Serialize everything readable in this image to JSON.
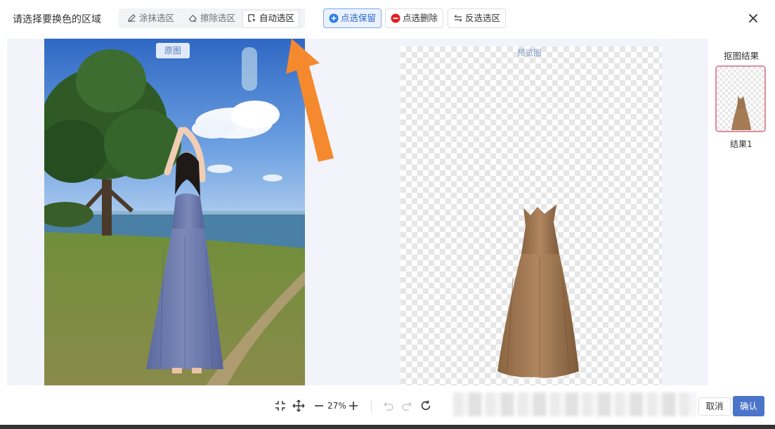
{
  "header": {
    "title": "请选择要换色的区域",
    "modes": [
      {
        "label": "涂抹选区",
        "icon": "pencil-icon",
        "active": false
      },
      {
        "label": "擦除选区",
        "icon": "eraser-icon",
        "active": false
      },
      {
        "label": "自动选区",
        "icon": "auto-select-icon",
        "active": true
      }
    ],
    "actions": [
      {
        "label": "点选保留",
        "icon": "plus-circle-icon",
        "primary": true
      },
      {
        "label": "点选删除",
        "icon": "minus-circle-icon",
        "primary": false
      },
      {
        "label": "反选选区",
        "icon": "swap-icon",
        "primary": false
      }
    ],
    "close_icon": "close-icon"
  },
  "canvas": {
    "original_label": "原图",
    "preview_label": "预览图"
  },
  "results": {
    "title": "抠图结果",
    "items": [
      {
        "label": "结果1"
      }
    ]
  },
  "footer": {
    "zoom": "27%",
    "cancel_label": "取消",
    "confirm_label": "确认"
  },
  "colors": {
    "primary": "#4a74c9",
    "accent_arrow": "#f5892e",
    "selected_border": "#e08ba0",
    "delete_red": "#e02020",
    "keep_blue": "#2d7be5"
  }
}
